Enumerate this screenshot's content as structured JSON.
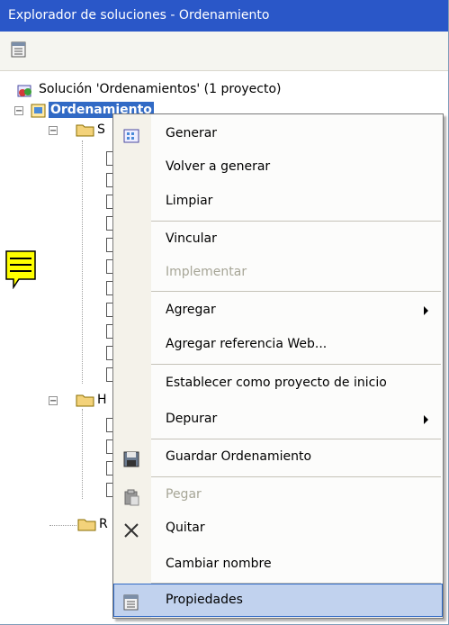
{
  "window": {
    "title": "Explorador de soluciones - Ordenamiento"
  },
  "toolbar": {
    "properties_icon": "properties-icon"
  },
  "tree": {
    "solution_label": "Solución 'Ordenamientos' (1 proyecto)",
    "project_label": "Ordenamiento",
    "folder1_label": "S",
    "folder2_label": "H",
    "folder3_label": "R"
  },
  "context_menu": {
    "items": [
      {
        "label": "Generar",
        "icon": "build-icon"
      },
      {
        "label": "Volver a generar"
      },
      {
        "label": "Limpiar"
      },
      {
        "label": "Vincular"
      },
      {
        "label": "Implementar"
      },
      {
        "label": "Agregar"
      },
      {
        "label": "Agregar referencia Web..."
      },
      {
        "label": "Establecer como proyecto de inicio"
      },
      {
        "label": "Depurar"
      },
      {
        "label": "Guardar Ordenamiento",
        "icon": "save-icon"
      },
      {
        "label": "Pegar",
        "icon": "paste-icon"
      },
      {
        "label": "Quitar",
        "icon": "delete-icon"
      },
      {
        "label": "Cambiar nombre"
      },
      {
        "label": "Propiedades",
        "icon": "properties-icon"
      }
    ]
  },
  "colors": {
    "title_bar": "#2a57c8",
    "selection": "#c1d2ee",
    "note": "#ffff00"
  }
}
